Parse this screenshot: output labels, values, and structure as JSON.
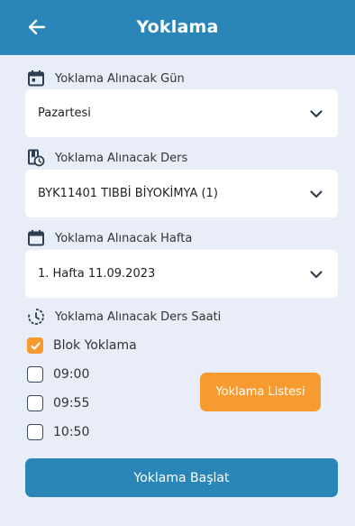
{
  "header": {
    "title": "Yoklama",
    "back_icon": "arrow-left-icon"
  },
  "day": {
    "label": "Yoklama Alınacak Gün",
    "value": "Pazartesi",
    "icon": "calendar-day-icon"
  },
  "course": {
    "label": "Yoklama Alınacak Ders",
    "value": "BYK11401 TIBBİ BİYOKİMYA (1)",
    "icon": "course-schedule-icon"
  },
  "week": {
    "label": "Yoklama Alınacak Hafta",
    "value": "1. Hafta 11.09.2023",
    "icon": "calendar-icon"
  },
  "hours": {
    "label": "Yoklama Alınacak Ders Saati",
    "icon": "clock-icon",
    "block": {
      "label": "Blok Yoklama",
      "checked": true
    },
    "slots": [
      {
        "label": "09:00",
        "checked": false
      },
      {
        "label": "09:55",
        "checked": false
      },
      {
        "label": "10:50",
        "checked": false
      }
    ]
  },
  "buttons": {
    "list": "Yoklama Listesi",
    "start": "Yoklama Başlat"
  },
  "colors": {
    "primary": "#2a85b8",
    "accent": "#f79a2f",
    "background": "#e8edf7"
  }
}
